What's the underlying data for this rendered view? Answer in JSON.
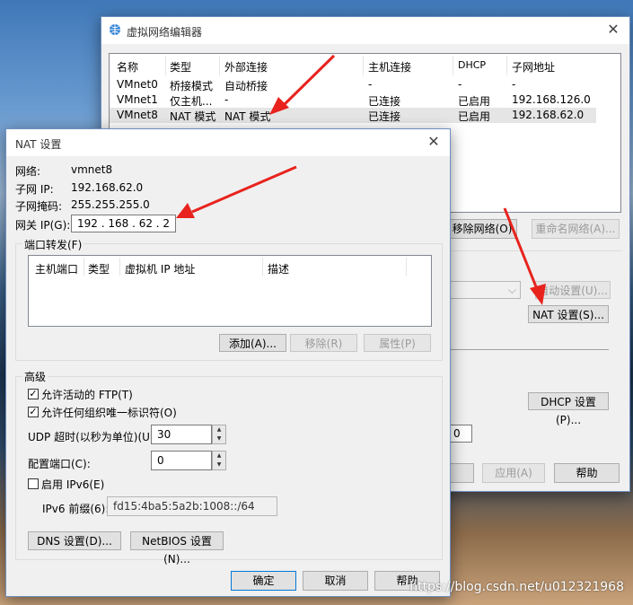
{
  "bg_window": {
    "title": "虚拟网络编辑器",
    "table": {
      "headers": [
        "名称",
        "类型",
        "外部连接",
        "主机连接",
        "DHCP",
        "子网地址"
      ],
      "rows": [
        [
          "VMnet0",
          "桥接模式",
          "自动桥接",
          "-",
          "-",
          "-"
        ],
        [
          "VMnet1",
          "仅主机...",
          "-",
          "已连接",
          "已启用",
          "192.168.126.0"
        ],
        [
          "VMnet8",
          "NAT 模式",
          "NAT 模式",
          "已连接",
          "已启用",
          "192.168.62.0"
        ]
      ]
    },
    "remove_network_btn": "移除网络(O)",
    "rename_network_btn": "重命名网络(A)...",
    "auto_settings_btn": "自动设置(U)...",
    "nat_settings_btn": "NAT 设置(S)...",
    "dhcp_settings_btn": "DHCP 设置(P)...",
    "mask_field_value": "0",
    "apply_btn": "应用(A)",
    "help_btn": "帮助"
  },
  "nat_dialog": {
    "title": "NAT 设置",
    "network_label": "网络:",
    "network_value": "vmnet8",
    "subnet_ip_label": "子网 IP:",
    "subnet_ip_value": "192.168.62.0",
    "subnet_mask_label": "子网掩码:",
    "subnet_mask_value": "255.255.255.0",
    "gateway_label": "网关 IP(G):",
    "gateway_value": "192 . 168 . 62 . 2",
    "port_forward_group": "端口转发(F)",
    "pf_headers": [
      "主机端口",
      "类型",
      "虚拟机 IP 地址",
      "描述"
    ],
    "add_btn": "添加(A)...",
    "remove_btn": "移除(R)",
    "props_btn": "属性(P)",
    "advanced_group": "高级",
    "allow_ftp": "允许活动的 FTP(T)",
    "allow_ftp_checked": true,
    "allow_oui": "允许任何组织唯一标识符(O)",
    "allow_oui_checked": true,
    "udp_timeout_label": "UDP 超时(以秒为单位)(U):",
    "udp_timeout_value": "30",
    "config_port_label": "配置端口(C):",
    "config_port_value": "0",
    "enable_ipv6": "启用 IPv6(E)",
    "enable_ipv6_checked": false,
    "ipv6_prefix_label": "IPv6 前缀(6):",
    "ipv6_prefix_value": "fd15:4ba5:5a2b:1008::/64",
    "dns_btn": "DNS 设置(D)...",
    "netbios_btn": "NetBIOS 设置(N)...",
    "ok_btn": "确定",
    "cancel_btn": "取消",
    "help_btn": "帮助"
  },
  "watermark": "https://blog.csdn.net/u012321968",
  "colors": {
    "arrow": "#e8231d",
    "selection": "#e5e5e5"
  }
}
